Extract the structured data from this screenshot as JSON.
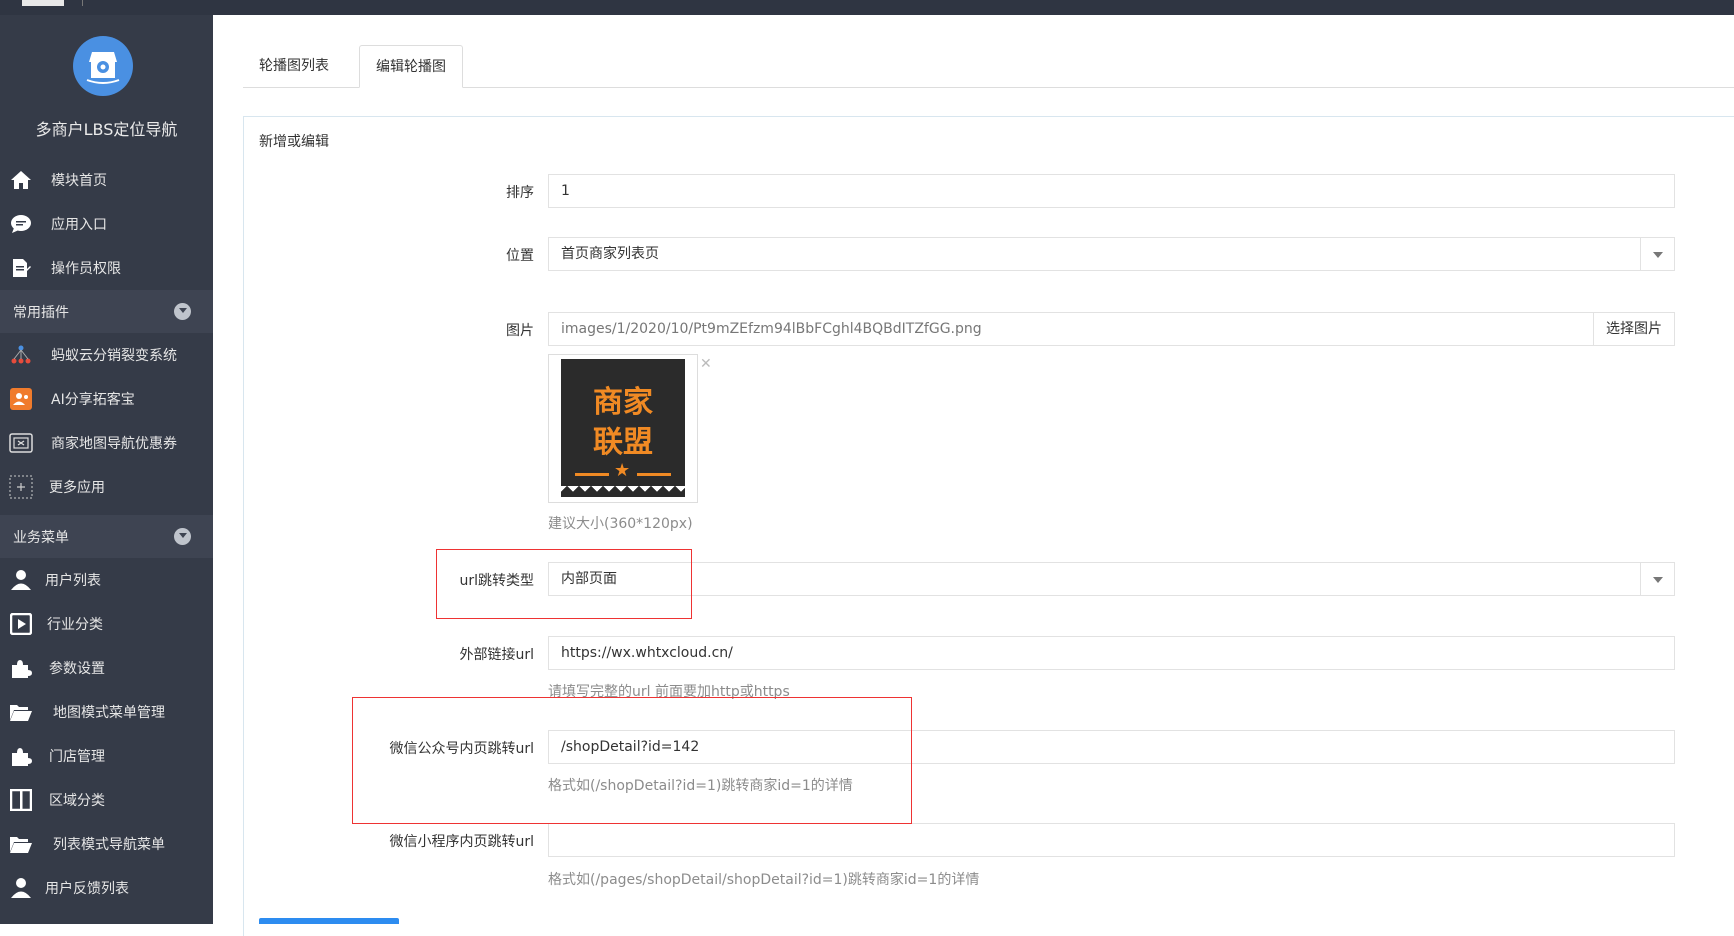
{
  "sidebar": {
    "brand_title": "多商户LBS定位导航",
    "items_top": [
      {
        "label": "模块首页",
        "icon": "home-icon"
      },
      {
        "label": "应用入口",
        "icon": "chat-icon"
      },
      {
        "label": "操作员权限",
        "icon": "document-edit-icon"
      }
    ],
    "group_plugins": "常用插件",
    "items_plugins": [
      {
        "label": "蚂蚁云分销裂变系统",
        "icon": "network-icon"
      },
      {
        "label": "AI分享拓客宝",
        "icon": "share-user-icon"
      },
      {
        "label": "商家地图导航优惠券",
        "icon": "coupon-icon"
      },
      {
        "label": "更多应用",
        "icon": "plus-box-icon"
      }
    ],
    "group_business": "业务菜单",
    "items_business": [
      {
        "label": "用户列表",
        "icon": "user-icon"
      },
      {
        "label": "行业分类",
        "icon": "play-square-icon"
      },
      {
        "label": "参数设置",
        "icon": "puzzle-icon"
      },
      {
        "label": "地图模式菜单管理",
        "icon": "folder-open-icon"
      },
      {
        "label": "门店管理",
        "icon": "puzzle-icon"
      },
      {
        "label": "区域分类",
        "icon": "columns-icon"
      },
      {
        "label": "列表模式导航菜单",
        "icon": "folder-open-icon"
      },
      {
        "label": "用户反馈列表",
        "icon": "user-icon"
      }
    ]
  },
  "tabs": [
    "轮播图列表",
    "编辑轮播图"
  ],
  "panel_title": "新增或编辑",
  "form": {
    "sort_label": "排序",
    "sort_value": "1",
    "position_label": "位置",
    "position_value": "首页商家列表页",
    "image_label": "图片",
    "image_path": "images/1/2020/10/Pt9mZEfzm94lBbFCghl4BQBdITZfGG.png",
    "pick_image_button": "选择图片",
    "image_art_line1": "商家",
    "image_art_line2": "联盟",
    "image_size_hint": "建议大小(360*120px)",
    "url_type_label": "url跳转类型",
    "url_type_value": "内部页面",
    "external_url_label": "外部链接url",
    "external_url_value": "https://wx.whtxcloud.cn/",
    "external_url_hint": "请填写完整的url 前面要加http或https",
    "wechat_mp_label": "微信公众号内页跳转url",
    "wechat_mp_value": "/shopDetail?id=142",
    "wechat_mp_hint": "格式如(/shopDetail?id=1)跳转商家id=1的详情",
    "miniprogram_label": "微信小程序内页跳转url",
    "miniprogram_value": "",
    "miniprogram_hint": "格式如(/pages/shopDetail/shopDetail?id=1)跳转商家id=1的详情"
  },
  "colors": {
    "sidebar_bg": "#353b48",
    "highlight_box": "#e33333",
    "accent_blue": "#2d8cf0",
    "image_orange": "#f08a24"
  }
}
